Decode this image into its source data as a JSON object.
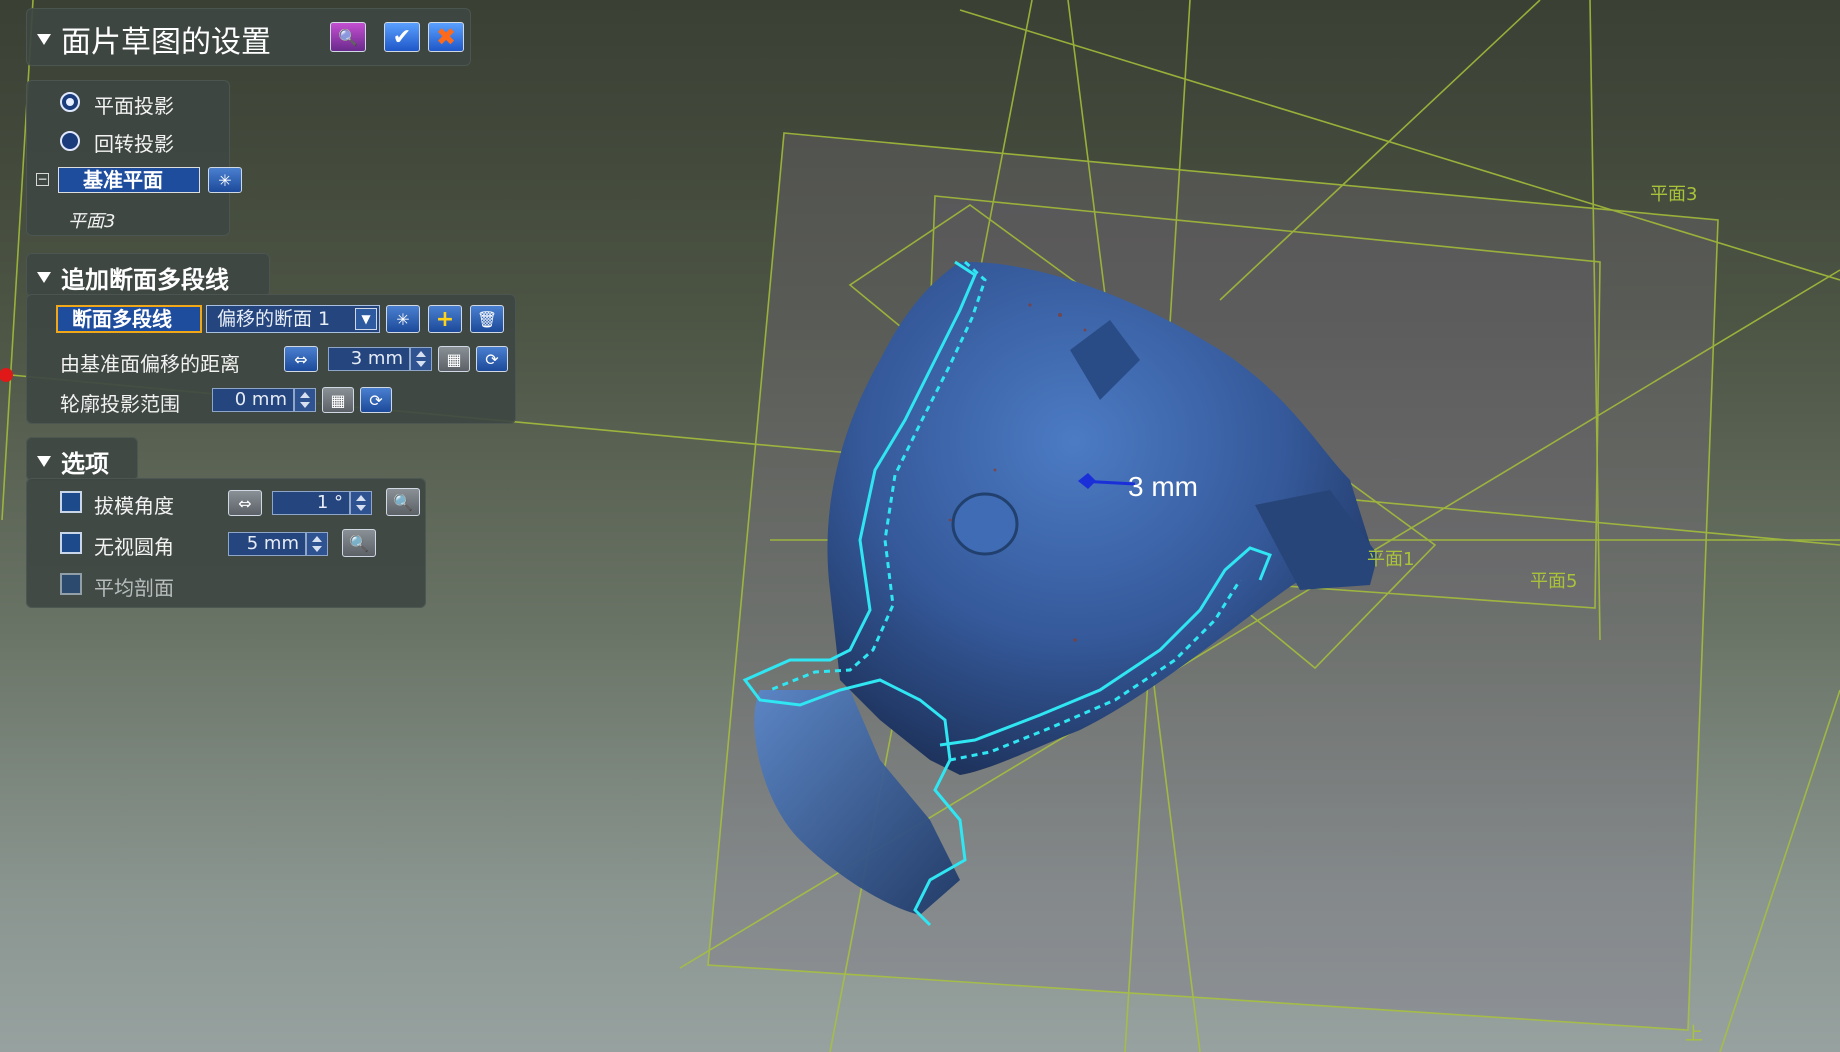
{
  "panel": {
    "title": "面片草图的设置",
    "projection": {
      "plane_label": "平面投影",
      "rotation_label": "回转投影",
      "selected": "plane"
    },
    "reference_plane": {
      "label": "基准平面",
      "value": "平面3"
    },
    "polyline_section": {
      "title": "追加断面多段线",
      "polyline_label": "断面多段线",
      "dropdown_value": "偏移的断面 1",
      "offset_label": "由基准面偏移的距离",
      "offset_value": "3 mm",
      "range_label": "轮廓投影范围",
      "range_value": "0 mm"
    },
    "options_section": {
      "title": "选项",
      "draft_label": "拔模角度",
      "draft_value": "1 °",
      "fillet_label": "无视圆角",
      "fillet_value": "5 mm",
      "avg_label": "平均剖面"
    }
  },
  "viewport": {
    "dimension_label": "3 mm",
    "plane_labels": [
      "平面3",
      "平面1",
      "平面5",
      "上"
    ],
    "colors": {
      "plane_lines": "#a8c23a",
      "section_lines": "#2fe6f2",
      "model": "#3a62a6"
    }
  }
}
